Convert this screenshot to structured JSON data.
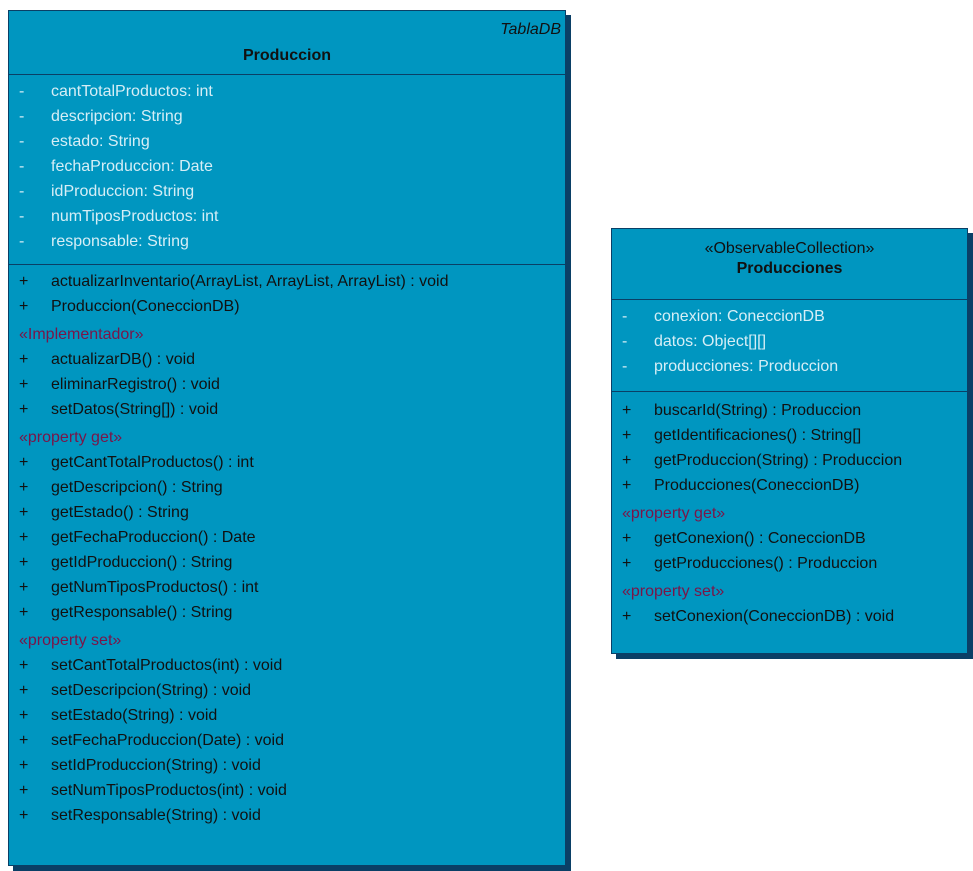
{
  "classes": [
    {
      "tag": "TablaDB",
      "stereotype": "",
      "name": "Produccion",
      "attributes": [
        {
          "vis": "-",
          "text": "cantTotalProductos: int"
        },
        {
          "vis": "-",
          "text": "descripcion: String"
        },
        {
          "vis": "-",
          "text": "estado: String"
        },
        {
          "vis": "-",
          "text": "fechaProduccion: Date"
        },
        {
          "vis": "-",
          "text": "idProduccion: String"
        },
        {
          "vis": "-",
          "text": "numTiposProductos: int"
        },
        {
          "vis": "-",
          "text": "responsable: String"
        }
      ],
      "operations": [
        {
          "vis": "+",
          "text": "actualizarInventario(ArrayList, ArrayList, ArrayList) : void"
        },
        {
          "vis": "+",
          "text": "Produccion(ConeccionDB)"
        }
      ],
      "groups": [
        {
          "label": "«Implementador»",
          "operations": [
            {
              "vis": "+",
              "text": "actualizarDB() : void"
            },
            {
              "vis": "+",
              "text": "eliminarRegistro() : void"
            },
            {
              "vis": "+",
              "text": "setDatos(String[]) : void"
            }
          ]
        },
        {
          "label": "«property get»",
          "operations": [
            {
              "vis": "+",
              "text": "getCantTotalProductos() : int"
            },
            {
              "vis": "+",
              "text": "getDescripcion() : String"
            },
            {
              "vis": "+",
              "text": "getEstado() : String"
            },
            {
              "vis": "+",
              "text": "getFechaProduccion() : Date"
            },
            {
              "vis": "+",
              "text": "getIdProduccion() : String"
            },
            {
              "vis": "+",
              "text": "getNumTiposProductos() : int"
            },
            {
              "vis": "+",
              "text": "getResponsable() : String"
            }
          ]
        },
        {
          "label": "«property set»",
          "operations": [
            {
              "vis": "+",
              "text": "setCantTotalProductos(int) : void"
            },
            {
              "vis": "+",
              "text": "setDescripcion(String) : void"
            },
            {
              "vis": "+",
              "text": "setEstado(String) : void"
            },
            {
              "vis": "+",
              "text": "setFechaProduccion(Date) : void"
            },
            {
              "vis": "+",
              "text": "setIdProduccion(String) : void"
            },
            {
              "vis": "+",
              "text": "setNumTiposProductos(int) : void"
            },
            {
              "vis": "+",
              "text": "setResponsable(String) : void"
            }
          ]
        }
      ]
    },
    {
      "tag": "",
      "stereotype": "«ObservableCollection»",
      "name": "Producciones",
      "attributes": [
        {
          "vis": "-",
          "text": "conexion: ConeccionDB"
        },
        {
          "vis": "-",
          "text": "datos: Object[][]"
        },
        {
          "vis": "-",
          "text": "producciones: Produccion"
        }
      ],
      "operations": [
        {
          "vis": "+",
          "text": "buscarId(String) : Produccion"
        },
        {
          "vis": "+",
          "text": "getIdentificaciones() : String[]"
        },
        {
          "vis": "+",
          "text": "getProduccion(String) : Produccion"
        },
        {
          "vis": "+",
          "text": "Producciones(ConeccionDB)"
        }
      ],
      "groups": [
        {
          "label": "«property get»",
          "operations": [
            {
              "vis": "+",
              "text": "getConexion() : ConeccionDB"
            },
            {
              "vis": "+",
              "text": "getProducciones() : Produccion"
            }
          ]
        },
        {
          "label": "«property set»",
          "operations": [
            {
              "vis": "+",
              "text": "setConexion(ConeccionDB) : void"
            }
          ]
        }
      ]
    }
  ],
  "colors": {
    "class_fill": "#0096c0",
    "border": "#0a3f66",
    "attribute_text": "#d6eef6",
    "stereotype_text": "#7a1548"
  }
}
